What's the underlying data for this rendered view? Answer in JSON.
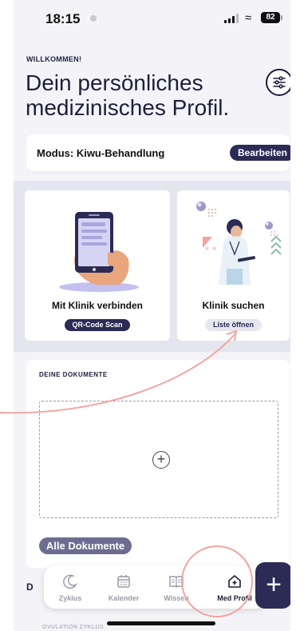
{
  "status": {
    "time": "18:15",
    "battery": "82"
  },
  "header": {
    "welcome": "WILLKOMMEN!",
    "title_line1": "Dein persönliches",
    "title_line2": "medizinisches Profil."
  },
  "mode": {
    "label": "Modus: Kiwu-Behandlung",
    "edit_label": "Bearbeiten"
  },
  "cards": [
    {
      "title": "Mit Klinik verbinden",
      "button": "QR-Code Scan"
    },
    {
      "title": "Klinik suchen",
      "button": "Liste öffnen"
    }
  ],
  "documents": {
    "title": "DEINE DOKUMENTE",
    "add_icon": "+",
    "all_button": "Alle Dokumente"
  },
  "hints": {
    "partial_letter": "D",
    "footer_partial": "OVULATION ZYKLUS"
  },
  "tabs": [
    {
      "label": "Zyklus",
      "icon": "moon-icon"
    },
    {
      "label": "Kalender",
      "icon": "calendar-icon"
    },
    {
      "label": "Wissen",
      "icon": "book-icon"
    },
    {
      "label": "Med Profil",
      "icon": "house-plus-icon"
    }
  ],
  "fab": {
    "label": "+"
  },
  "colors": {
    "navy": "#2b2b55",
    "annotation": "#f2a5a0",
    "band": "#e4e5ef"
  }
}
